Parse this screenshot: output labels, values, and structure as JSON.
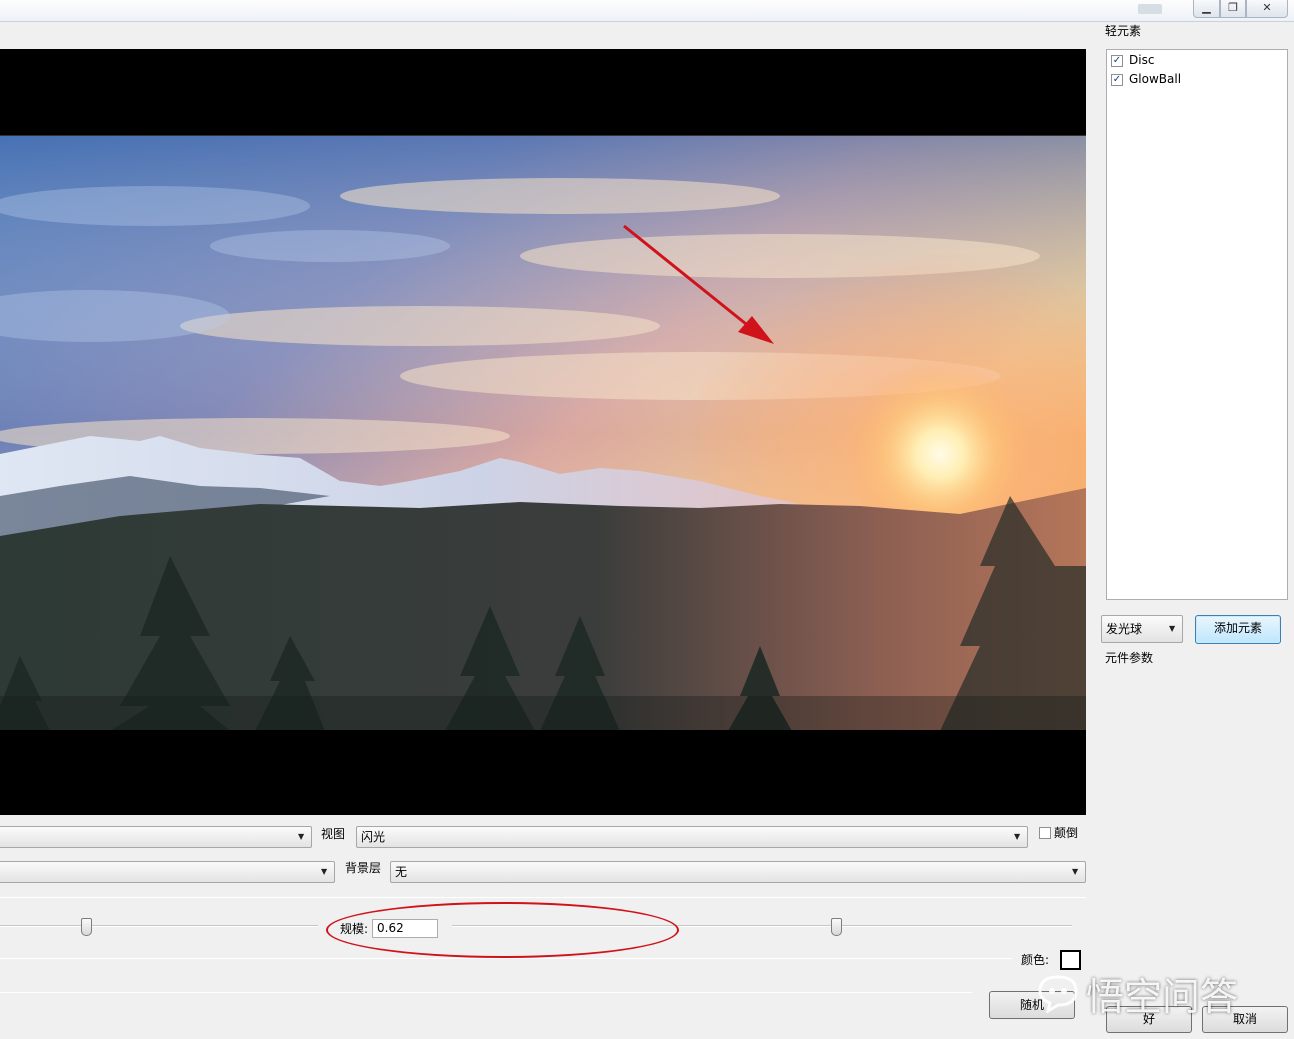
{
  "rightpane": {
    "elements_title": "轻元素",
    "elements": [
      {
        "label": "Disc",
        "checked": true
      },
      {
        "label": "GlowBall",
        "checked": true
      }
    ],
    "element_type_select": "发光球",
    "add_element_button": "添加元素",
    "params_title": "元件参数",
    "ok_button": "好",
    "cancel_button": "取消"
  },
  "controls": {
    "view_label": "视图",
    "view_value": "闪光",
    "flip_label": "颠倒",
    "flip_checked": false,
    "background_label": "背景层",
    "background_value": "无",
    "scale_label": "规模:",
    "scale_value": "0.62",
    "color_label": "颜色:",
    "random_button": "随机",
    "left_slider_level": 0.27,
    "scale_slider_level": 0.62
  },
  "watermark": "悟空问答",
  "colors": {
    "annotation_red": "#d0131b",
    "accent_button": "#bee6fd"
  }
}
